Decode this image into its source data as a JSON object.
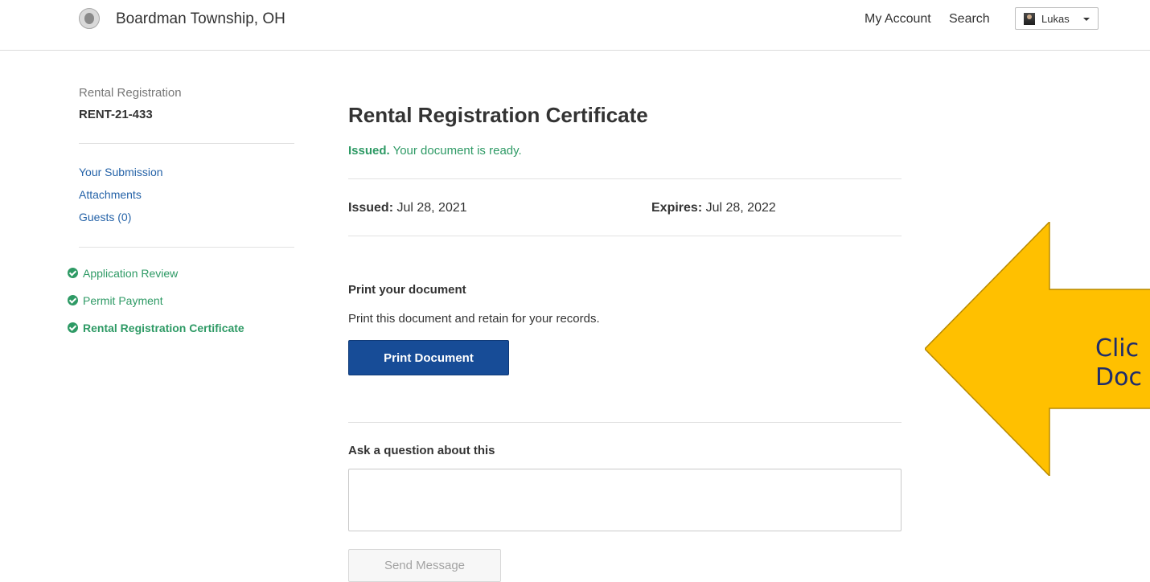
{
  "header": {
    "site_name": "Boardman Township, OH",
    "my_account": "My Account",
    "search": "Search",
    "user_name": "Lukas"
  },
  "sidebar": {
    "record_type": "Rental Registration",
    "record_id": "RENT-21-433",
    "links": [
      "Your Submission",
      "Attachments",
      "Guests (0)"
    ],
    "steps": [
      "Application Review",
      "Permit Payment",
      "Rental Registration Certificate"
    ]
  },
  "main": {
    "title": "Rental Registration Certificate",
    "status_label": "Issued.",
    "status_text": " Your document is ready.",
    "issued_label": "Issued:",
    "issued_date": " Jul 28, 2021",
    "expires_label": "Expires:",
    "expires_date": " Jul 28, 2022",
    "print_heading": "Print your document",
    "print_text": "Print this document and retain for your records.",
    "print_button": "Print Document",
    "question_heading": "Ask a question about this",
    "question_value": "",
    "send_button": "Send Message"
  },
  "callout": {
    "line1": "Clic",
    "line2": "Doc",
    "color": "#ffc000"
  },
  "colors": {
    "accent": "#174c97",
    "success": "#2e9a65",
    "link": "#2563a8"
  }
}
